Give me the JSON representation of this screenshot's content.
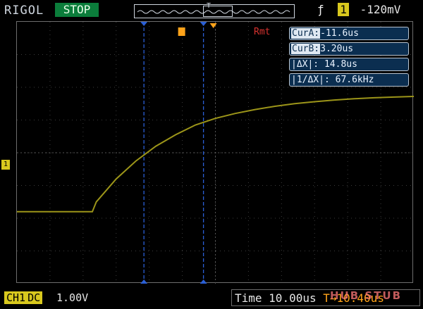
{
  "header": {
    "brand": "RIGOL",
    "status": "STOP",
    "trigger": {
      "edge_symbol": "ƒ",
      "channel": "1",
      "level": "-120mV"
    }
  },
  "markers": {
    "trigger_pos": "T",
    "channel_marker": "1"
  },
  "screen_label": "Rmt",
  "cursors": {
    "cur_a_label": "CurA:",
    "cur_a_value": "-11.6us",
    "cur_b_label": "CurB:",
    "cur_b_value": "3.20us",
    "delta_x": "|ΔX|: 14.8us",
    "inv_delta_x": "|1/ΔX|: 67.6kHz"
  },
  "footer": {
    "channel": "CH1",
    "coupling": "DC",
    "volts_div": "1.00V",
    "time_label": "Time",
    "time_div": "10.00us",
    "trigger_offset": "T→10.40us"
  },
  "watermark": "HUB STUB",
  "colors": {
    "trace": "#9c9519",
    "cursor": "#2a5fd6",
    "grid": "#3c3c3c",
    "status_bg": "#0b7d3b",
    "trigger": "#ffa31a"
  },
  "chart_data": {
    "type": "line",
    "series": [
      {
        "values": [
          [
            0,
            -1.8
          ],
          [
            0.19,
            -1.8
          ],
          [
            0.2,
            -1.5
          ],
          [
            0.25,
            -0.8
          ],
          [
            0.3,
            -0.25
          ],
          [
            0.35,
            0.2
          ],
          [
            0.4,
            0.55
          ],
          [
            0.45,
            0.85
          ],
          [
            0.5,
            1.05
          ],
          [
            0.55,
            1.2
          ],
          [
            0.6,
            1.32
          ],
          [
            0.65,
            1.42
          ],
          [
            0.7,
            1.5
          ],
          [
            0.75,
            1.56
          ],
          [
            0.8,
            1.61
          ],
          [
            0.85,
            1.65
          ],
          [
            0.9,
            1.68
          ],
          [
            0.95,
            1.7
          ],
          [
            1.0,
            1.72
          ]
        ]
      }
    ],
    "xlim": [
      0,
      1
    ],
    "ylim": [
      -4,
      4
    ],
    "cursor_x": [
      0.32,
      0.47
    ],
    "grid": true
  }
}
